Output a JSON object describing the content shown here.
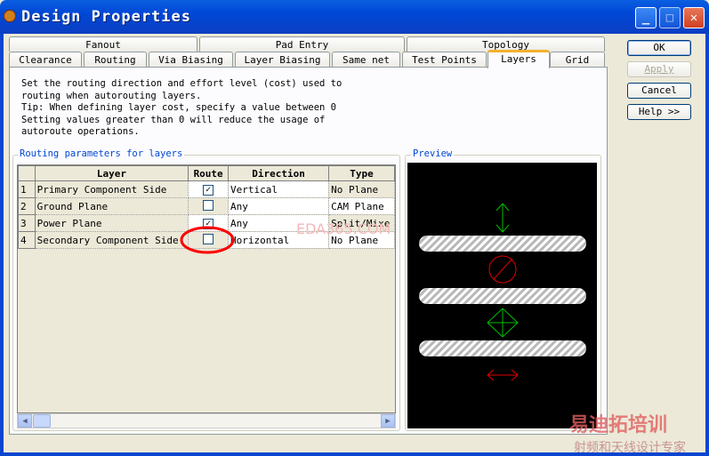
{
  "window": {
    "title": "Design Properties",
    "minimize": "_",
    "maximize": "□",
    "close": "✕"
  },
  "tabs_row1": [
    "Fanout",
    "Pad Entry",
    "Topology"
  ],
  "tabs_row2": [
    "Clearance",
    "Routing",
    "Via Biasing",
    "Layer Biasing",
    "Same net",
    "Test Points",
    "Layers",
    "Grid"
  ],
  "active_tab": "Layers",
  "buttons": {
    "ok": "OK",
    "apply": "Apply",
    "cancel": "Cancel",
    "help": "Help >>"
  },
  "description": "Set the routing direction and effort level (cost) used to\nrouting when autorouting layers.\nTip: When defining layer cost, specify a value between 0\nSetting values greater than 0 will reduce the usage of\nautoroute operations.",
  "routing_group": {
    "label": "Routing parameters for layers",
    "columns": [
      "Layer",
      "Route",
      "Direction",
      "Type"
    ],
    "rows": [
      {
        "num": "1",
        "layer": "Primary Component Side",
        "route": true,
        "direction": "Vertical",
        "type": "No Plane"
      },
      {
        "num": "2",
        "layer": "Ground Plane",
        "route": false,
        "direction": "Any",
        "type": "CAM Plane"
      },
      {
        "num": "3",
        "layer": "Power Plane",
        "route": true,
        "direction": "Any",
        "type": "Split/Mixe"
      },
      {
        "num": "4",
        "layer": "Secondary Component Side",
        "route": false,
        "direction": "Horizontal",
        "type": "No Plane"
      }
    ]
  },
  "preview": {
    "label": "Preview"
  },
  "colors": {
    "accent": "#0046d5",
    "green": "#00c000",
    "red": "#e00000"
  },
  "watermarks": {
    "center": "EDA365.COM",
    "logo": "易迪拓培训",
    "tagline": "射频和天线设计专家"
  }
}
